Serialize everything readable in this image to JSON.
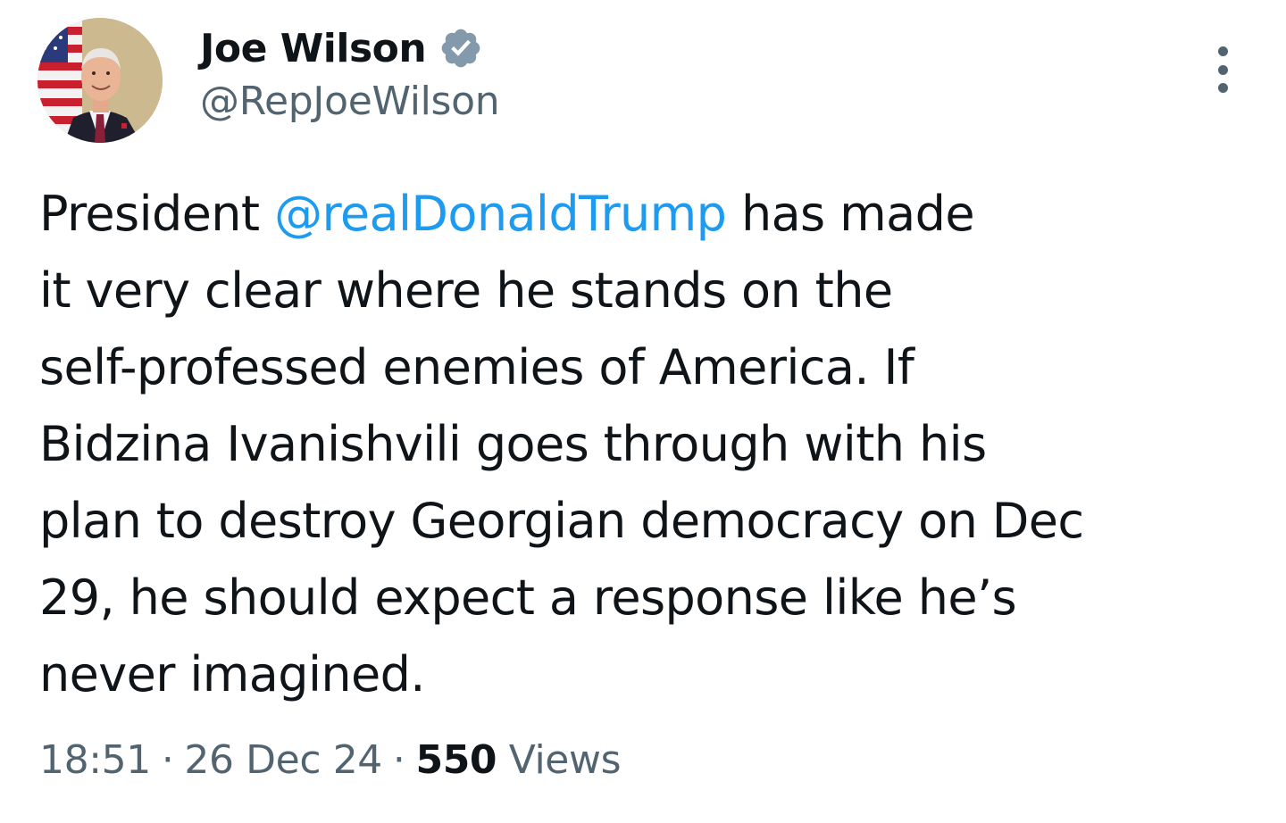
{
  "author": {
    "display_name": "Joe Wilson",
    "handle": "@RepJoeWilson",
    "verified_icon": "verified-badge-icon",
    "avatar_icon": "profile-photo"
  },
  "menu": {
    "icon": "more-options-icon"
  },
  "tweet": {
    "text_before": "President ",
    "mention": "@realDonaldTrump",
    "text_after": " has made\nit very clear where he stands on the\nself-professed enemies of America. If\nBidzina Ivanishvili goes through with his\nplan to destroy Georgian democracy on Dec\n29, he should expect a response like he’s\nnever imagined."
  },
  "meta": {
    "time": "18:51",
    "separator": "·",
    "date": "26 Dec 24",
    "views_count": "550",
    "views_label": "Views"
  },
  "colors": {
    "text": "#0f1419",
    "secondary": "#536471",
    "link": "#1d9bf0",
    "verified": "#829aab"
  }
}
